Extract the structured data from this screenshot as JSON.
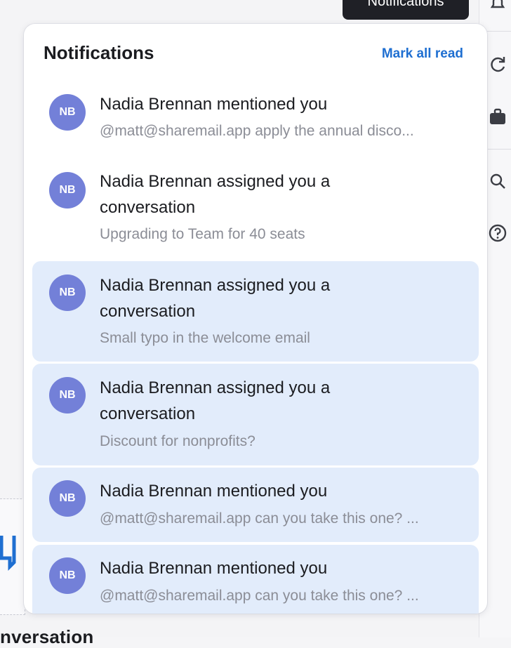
{
  "tooltip": {
    "label": "Notifications"
  },
  "panel": {
    "title": "Notifications",
    "mark_all_read": "Mark all read"
  },
  "notifications": [
    {
      "initials": "NB",
      "title": "Nadia Brennan mentioned you",
      "subtitle": "@matt@sharemail.app apply the annual disco...",
      "unread": false
    },
    {
      "initials": "NB",
      "title": "Nadia Brennan assigned you a conversation",
      "subtitle": "Upgrading to Team for 40 seats",
      "unread": false
    },
    {
      "initials": "NB",
      "title": "Nadia Brennan assigned you a conversation",
      "subtitle": "Small typo in the welcome email",
      "unread": true
    },
    {
      "initials": "NB",
      "title": "Nadia Brennan assigned you a conversation",
      "subtitle": "Discount for nonprofits?",
      "unread": true
    },
    {
      "initials": "NB",
      "title": "Nadia Brennan mentioned you",
      "subtitle": "@matt@sharemail.app can you take this one? ...",
      "unread": true
    },
    {
      "initials": "NB",
      "title": "Nadia Brennan mentioned you",
      "subtitle": "@matt@sharemail.app can you take this one? ...",
      "unread": true
    }
  ],
  "background": {
    "bottom_text": "nversation"
  },
  "colors": {
    "accent": "#1f6fd1",
    "avatar": "#7380d8",
    "unread_bg": "#e2ecfb"
  },
  "icons": [
    "bell-icon",
    "refresh-icon",
    "briefcase-icon",
    "search-icon",
    "help-icon",
    "inbox-icon"
  ]
}
